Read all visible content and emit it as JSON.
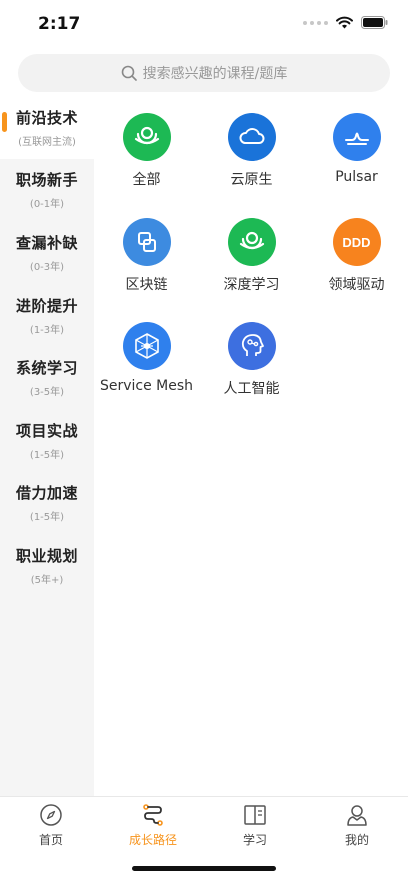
{
  "status": {
    "time": "2:17"
  },
  "search": {
    "placeholder": "搜索感兴趣的课程/题库"
  },
  "sidebar": {
    "items": [
      {
        "title": "前沿技术",
        "sub": "(互联网主流)",
        "active": true
      },
      {
        "title": "职场新手",
        "sub": "(0-1年)"
      },
      {
        "title": "查漏补缺",
        "sub": "(0-3年)"
      },
      {
        "title": "进阶提升",
        "sub": "(1-3年)"
      },
      {
        "title": "系统学习",
        "sub": "(3-5年)"
      },
      {
        "title": "项目实战",
        "sub": "(1-5年)"
      },
      {
        "title": "借力加速",
        "sub": "(1-5年)"
      },
      {
        "title": "职业规划",
        "sub": "(5年+)"
      }
    ]
  },
  "grid": {
    "items": [
      {
        "label": "全部",
        "icon": "layers-icon",
        "color": "#1db954"
      },
      {
        "label": "云原生",
        "icon": "cloud-icon",
        "color": "#1a73d9"
      },
      {
        "label": "Pulsar",
        "icon": "pulsar-icon",
        "color": "#2f80ed"
      },
      {
        "label": "区块链",
        "icon": "blockchain-icon",
        "color": "#3d8be0"
      },
      {
        "label": "深度学习",
        "icon": "deep-learning-icon",
        "color": "#1db954"
      },
      {
        "label": "领域驱动",
        "icon": "ddd-icon",
        "color": "#f7831e",
        "badge": "DDD"
      },
      {
        "label": "Service Mesh",
        "icon": "service-mesh-icon",
        "color": "#2f80ed"
      },
      {
        "label": "人工智能",
        "icon": "ai-head-icon",
        "color": "#3d6fe0"
      }
    ]
  },
  "tabs": [
    {
      "label": "首页",
      "icon": "compass-icon"
    },
    {
      "label": "成长路径",
      "icon": "path-icon",
      "active": true
    },
    {
      "label": "学习",
      "icon": "book-icon"
    },
    {
      "label": "我的",
      "icon": "user-icon"
    }
  ],
  "colors": {
    "accent": "#f7941d",
    "sidebar_bg": "#f5f5f5"
  }
}
